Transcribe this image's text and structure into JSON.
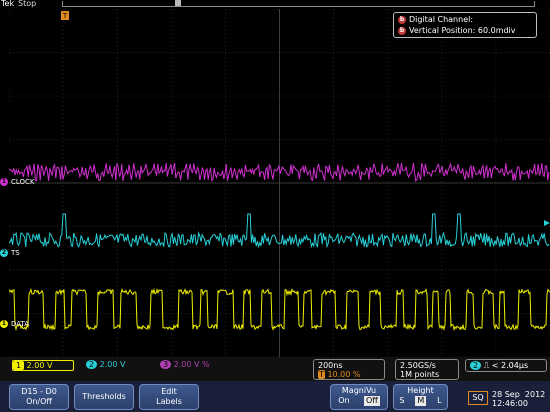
{
  "header": {
    "brand": "Tek",
    "run_state": "Stop"
  },
  "info_box": {
    "line1": "Digital Channel:",
    "line2": "Vertical Position: 60.0mdiv",
    "badge": "b"
  },
  "channels": {
    "clock": {
      "label": "CLOCK",
      "marker": "1",
      "color": "#d030d0"
    },
    "ts": {
      "label": "TS",
      "marker": "2",
      "color": "#28d0d8"
    },
    "data": {
      "label": "DATA",
      "marker": "1",
      "color": "#f0f000"
    }
  },
  "status": {
    "ch1_scale": "2.00 V",
    "ch1_num": "1",
    "ch2_scale": "2.00 V",
    "ch2_num": "2",
    "ch3_scale": "2.00 V",
    "ch3_num": "3",
    "ch3_suffix": "%",
    "horizontal": "200ns",
    "trigger_pct": "10.00 %",
    "sample_rate": "2.50GS/s",
    "record_length": "1M points",
    "trig_channel": "2",
    "trig_value": "< 2.04μs"
  },
  "menu": {
    "d15_d0_line1": "D15 - D0",
    "d15_d0_line2": "On/Off",
    "thresholds": "Thresholds",
    "edit_line1": "Edit",
    "edit_line2": "Labels",
    "magnivu": "MagniVu",
    "magnivu_on": "On",
    "magnivu_off": "Off",
    "height": "Height",
    "height_s": "S",
    "height_m": "M",
    "height_l": "L",
    "sq": "SQ",
    "date": "28 Sep  2012",
    "time": "12:46:00"
  },
  "colors": {
    "grid": "#4b4b4b",
    "bottom_bar": "#1a1f3a",
    "softkey": "#3f5a8f"
  }
}
